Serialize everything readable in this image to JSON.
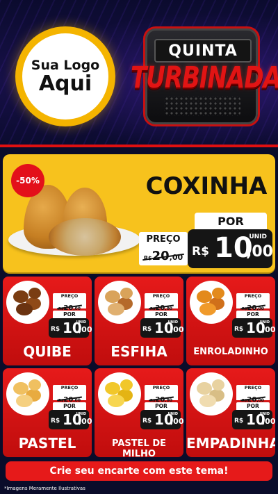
{
  "logo": {
    "line1": "Sua Logo",
    "line2": "Aqui"
  },
  "badge": {
    "line1": "QUINTA",
    "line2": "TURBINADA"
  },
  "featured": {
    "name": "COXINHA",
    "discount": "-50%",
    "preco_label": "PREÇO",
    "old_currency": "R$",
    "old_int": "20",
    "old_cents": ",00",
    "por_label": "POR",
    "unid_label": "UNID",
    "new_currency": "R$",
    "new_int": "10",
    "new_cents": ",00"
  },
  "products": [
    {
      "name": "QUIBE",
      "preco_label": "PREÇO",
      "old_currency": "R$",
      "old_int": "20",
      "old_cents": ",00",
      "por_label": "POR",
      "unid_label": "UNID",
      "new_currency": "R$",
      "new_int": "10",
      "new_cents": ",00",
      "food_icon": "quibe-icon"
    },
    {
      "name": "ESFIHA",
      "preco_label": "PREÇO",
      "old_currency": "R$",
      "old_int": "20",
      "old_cents": ",00",
      "por_label": "POR",
      "unid_label": "UNID",
      "new_currency": "R$",
      "new_int": "10",
      "new_cents": ",00",
      "food_icon": "esfiha-icon"
    },
    {
      "name": "ENROLADINHO",
      "preco_label": "PREÇO",
      "old_currency": "R$",
      "old_int": "20",
      "old_cents": ",00",
      "por_label": "POR",
      "unid_label": "UNID",
      "new_currency": "R$",
      "new_int": "10",
      "new_cents": ",00",
      "food_icon": "enroladinho-icon"
    },
    {
      "name": "PASTEL",
      "preco_label": "PREÇO",
      "old_currency": "R$",
      "old_int": "20",
      "old_cents": ",00",
      "por_label": "POR",
      "unid_label": "UNID",
      "new_currency": "R$",
      "new_int": "10",
      "new_cents": ",00",
      "food_icon": "pastel-icon"
    },
    {
      "name": "PASTEL DE MILHO",
      "preco_label": "PREÇO",
      "old_currency": "R$",
      "old_int": "20",
      "old_cents": ",00",
      "por_label": "POR",
      "unid_label": "UNID",
      "new_currency": "R$",
      "new_int": "10",
      "new_cents": ",00",
      "food_icon": "pastel-de-milho-icon"
    },
    {
      "name": "EMPADINHA",
      "preco_label": "PREÇO",
      "old_currency": "R$",
      "old_int": "20",
      "old_cents": ",00",
      "por_label": "POR",
      "unid_label": "UNID",
      "new_currency": "R$",
      "new_int": "10",
      "new_cents": ",00",
      "food_icon": "empadinha-icon"
    }
  ],
  "cta": "Crie seu encarte com este tema!",
  "disclaimer": "*Imagens Meramente Ilustrativas",
  "colors": {
    "red": "#e61a1a",
    "yellow": "#f7c21d",
    "dark": "#151515",
    "navy": "#0b0b2e"
  }
}
